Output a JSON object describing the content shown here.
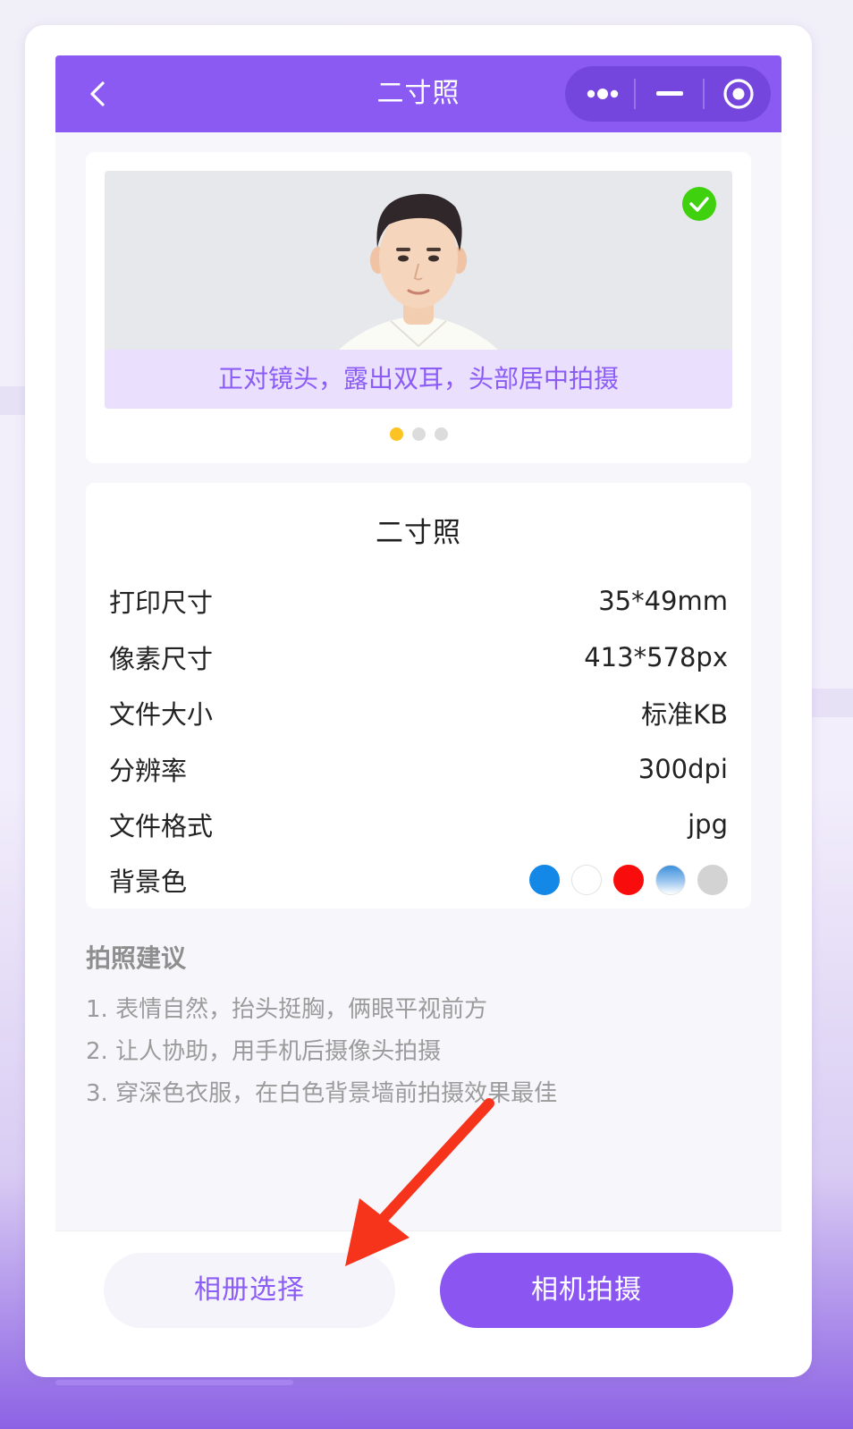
{
  "navbar": {
    "title": "二寸照"
  },
  "preview": {
    "caption": "正对镜头，露出双耳，头部居中拍摄",
    "carousel_pages": 3,
    "active_page": 1
  },
  "spec": {
    "title": "二寸照",
    "rows": [
      {
        "label": "打印尺寸",
        "value": "35*49mm"
      },
      {
        "label": "像素尺寸",
        "value": "413*578px"
      },
      {
        "label": "文件大小",
        "value": "标准KB"
      },
      {
        "label": "分辨率",
        "value": "300dpi"
      },
      {
        "label": "文件格式",
        "value": "jpg"
      }
    ],
    "bg_color_label": "背景色",
    "bg_colors": [
      "#1488e6",
      "#ffffff",
      "#f80c0c",
      "gradient-blue",
      "#d3d3d3"
    ]
  },
  "tips": {
    "title": "拍照建议",
    "items": [
      "1. 表情自然，抬头挺胸，俩眼平视前方",
      "2. 让人协助，用手机后摄像头拍摄",
      "3. 穿深色衣服，在白色背景墙前拍摄效果最佳"
    ]
  },
  "actions": {
    "album_label": "相册选择",
    "camera_label": "相机拍摄"
  },
  "colors": {
    "accent": "#8a5af2",
    "caption_text": "#8b5cf6",
    "annotation_arrow": "#f5341b"
  }
}
